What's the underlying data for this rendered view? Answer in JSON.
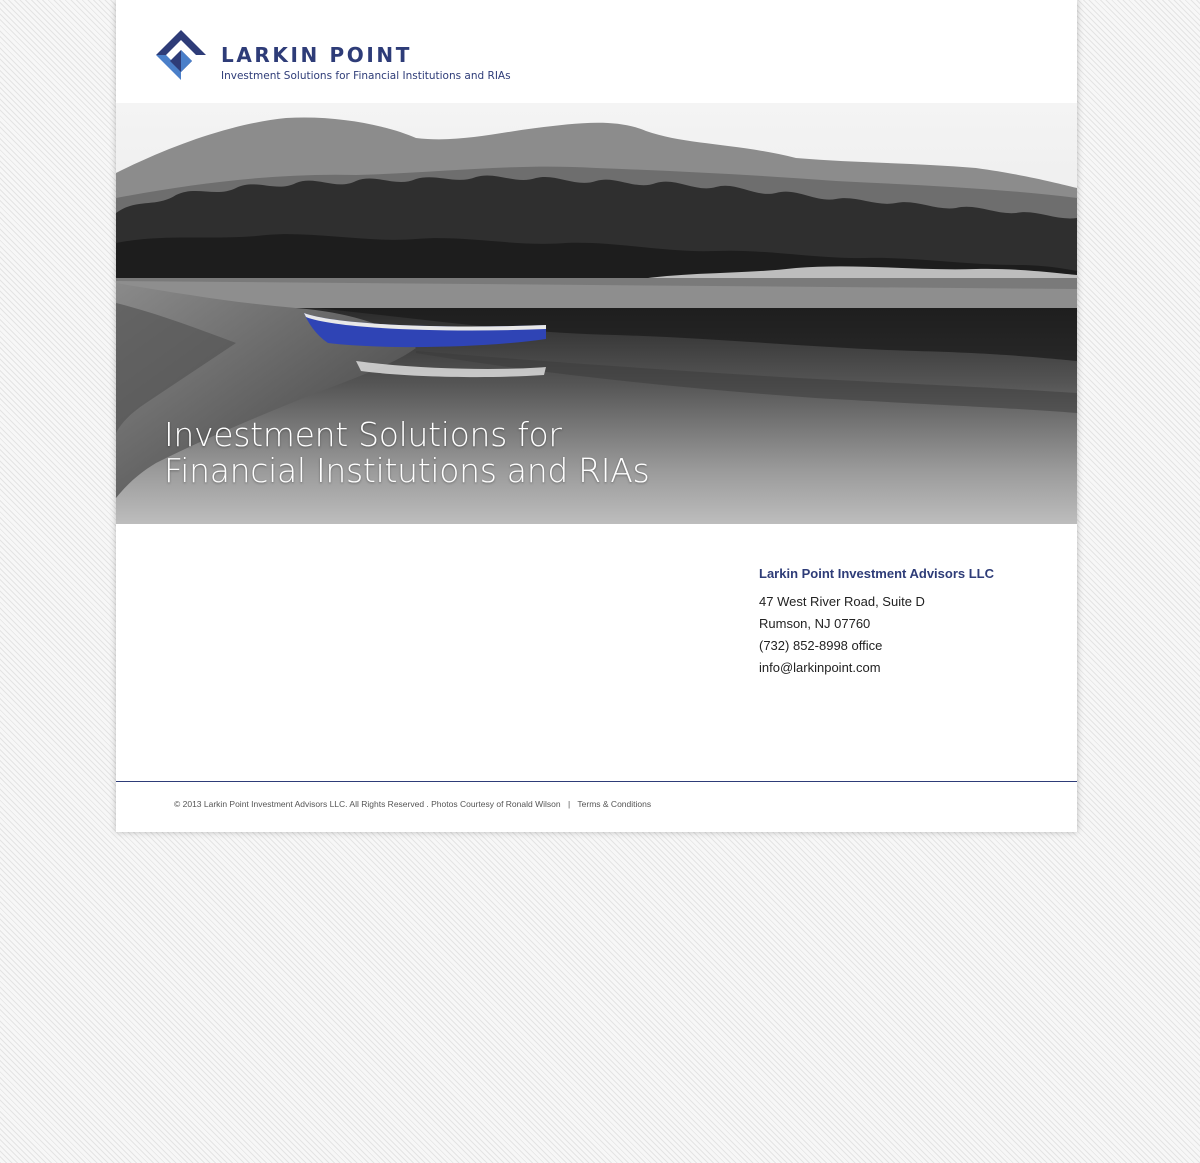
{
  "header": {
    "brand_name": "LARKIN POINT",
    "tagline": "Investment Solutions for Financial Institutions and RIAs",
    "logo_icon": "larkin-point-logo-icon",
    "brand_color": "#2e3c78",
    "accent_color": "#4a7fc9"
  },
  "hero": {
    "line1": "Investment Solutions for",
    "line2": "Financial Institutions and RIAs",
    "boat_color": "#2f44b5"
  },
  "contact": {
    "company": "Larkin Point Investment Advisors LLC",
    "address1": "47 West River Road, Suite D",
    "address2": "Rumson, NJ 07760",
    "phone": "(732) 852-8998 office",
    "email": "info@larkinpoint.com"
  },
  "footer": {
    "copyright": "© 2013 Larkin Point Investment Advisors LLC. All Rights Reserved . Photos Courtesy of Ronald Wilson",
    "separator": "|",
    "terms_link": "Terms & Conditions"
  }
}
